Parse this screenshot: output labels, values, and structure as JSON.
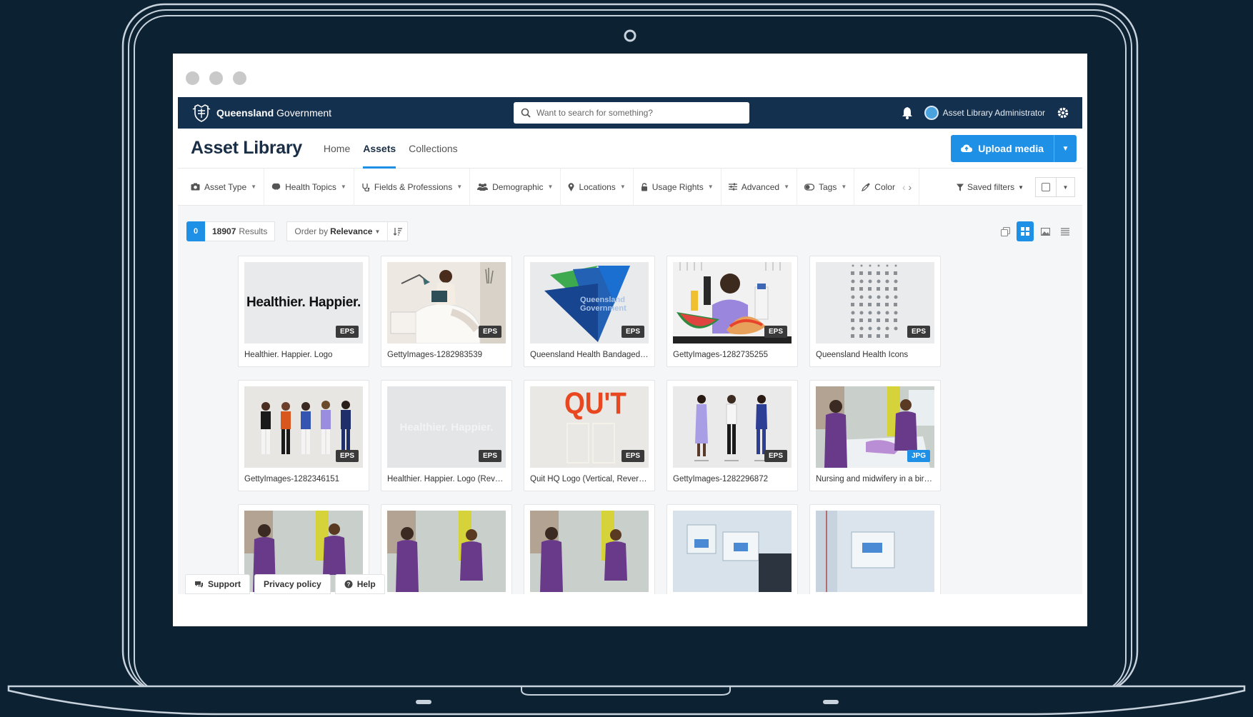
{
  "header": {
    "logo_bold": "Queensland",
    "logo_light": " Government",
    "search_placeholder": "Want to search for something?",
    "user_name": "Asset Library Administrator"
  },
  "subheader": {
    "app_title": "Asset Library",
    "nav": [
      "Home",
      "Assets",
      "Collections"
    ],
    "upload_label": "Upload media"
  },
  "filters": [
    {
      "icon": "camera-icon",
      "label": "Asset Type"
    },
    {
      "icon": "brain-icon",
      "label": "Health Topics"
    },
    {
      "icon": "stethoscope-icon",
      "label": "Fields & Professions"
    },
    {
      "icon": "users-icon",
      "label": "Demographic"
    },
    {
      "icon": "map-pin-icon",
      "label": "Locations"
    },
    {
      "icon": "lock-icon",
      "label": "Usage Rights"
    },
    {
      "icon": "sliders-icon",
      "label": "Advanced"
    },
    {
      "icon": "tag-icon",
      "label": "Tags"
    },
    {
      "icon": "eyedropper-icon",
      "label": "Color"
    }
  ],
  "saved_filters_label": "Saved filters",
  "results": {
    "selected_count": "0",
    "count": "18907",
    "count_suffix": "Results",
    "order_prefix": "Order by",
    "order_value": "Relevance"
  },
  "assets": [
    {
      "title": "Healthier. Happier. Logo",
      "type": "EPS",
      "thumb_text": "Healthier. Happier."
    },
    {
      "title": "GettyImages-1282983539",
      "type": "EPS",
      "thumb_text": ""
    },
    {
      "title": "Queensland Health Bandaged H...",
      "type": "EPS",
      "thumb_text": "Queensland Government"
    },
    {
      "title": "GettyImages-1282735255",
      "type": "EPS",
      "thumb_text": ""
    },
    {
      "title": "Queensland Health Icons",
      "type": "EPS",
      "thumb_text": ""
    },
    {
      "title": "GettyImages-1282346151",
      "type": "EPS",
      "thumb_text": ""
    },
    {
      "title": "Healthier. Happier. Logo (Revers...",
      "type": "EPS",
      "thumb_text": "Healthier. Happier."
    },
    {
      "title": "Quit HQ Logo (Vertical, Reversed)",
      "type": "EPS",
      "thumb_text": "QU'T"
    },
    {
      "title": "GettyImages-1282296872",
      "type": "EPS",
      "thumb_text": ""
    },
    {
      "title": "Nursing and midwifery in a birth...",
      "type": "JPG",
      "thumb_text": ""
    }
  ],
  "footer": {
    "support": "Support",
    "privacy": "Privacy policy",
    "help": "Help"
  },
  "colors": {
    "navy": "#14304f",
    "accent": "#1e90e6",
    "background": "#0c2233"
  }
}
